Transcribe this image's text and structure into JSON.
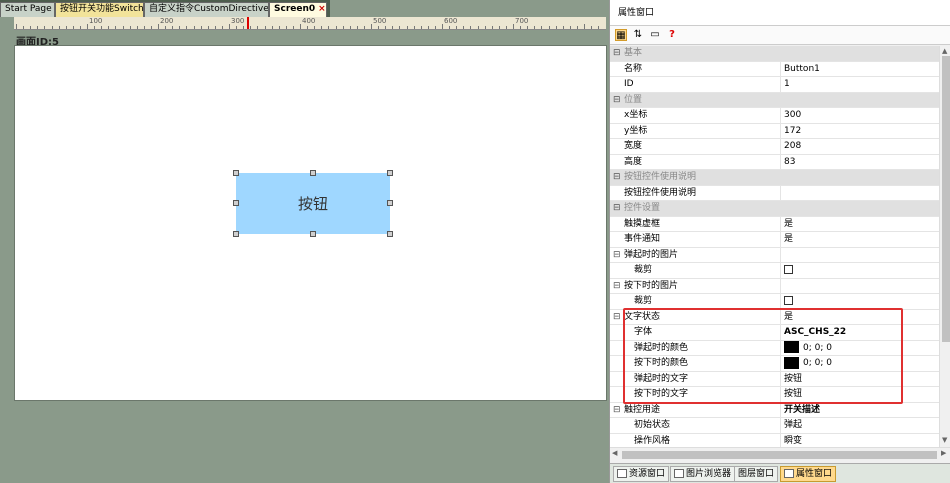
{
  "tabs": [
    {
      "label": "Start Page"
    },
    {
      "label": "按钮开关功能Switch"
    },
    {
      "label": "自定义指令CustomDirectives"
    },
    {
      "label": "Screen0",
      "close": "×"
    }
  ],
  "ruler": {
    "labels": [
      "100",
      "200",
      "300",
      "400",
      "500",
      "600",
      "700"
    ]
  },
  "screen_label": "画面ID:5",
  "canvas_button": {
    "label": "按钮"
  },
  "props": {
    "title": "属性窗口",
    "toolbar_icons": [
      "categorized-icon",
      "sort-alpha-icon",
      "property-pages-icon",
      "help-icon"
    ],
    "help_glyph": "?",
    "rows": [
      {
        "type": "cat",
        "name": "基本"
      },
      {
        "type": "prop",
        "name": "名称",
        "value": "Button1"
      },
      {
        "type": "prop",
        "name": "ID",
        "value": "1"
      },
      {
        "type": "cat",
        "name": "位置"
      },
      {
        "type": "prop",
        "name": "x坐标",
        "value": "300"
      },
      {
        "type": "prop",
        "name": "y坐标",
        "value": "172"
      },
      {
        "type": "prop",
        "name": "宽度",
        "value": "208"
      },
      {
        "type": "prop",
        "name": "高度",
        "value": "83"
      },
      {
        "type": "cat",
        "name": "按钮控件使用说明"
      },
      {
        "type": "prop",
        "name": "按钮控件使用说明",
        "value": ""
      },
      {
        "type": "cat",
        "name": "控件设置"
      },
      {
        "type": "prop",
        "name": "触摸虚框",
        "value": "是"
      },
      {
        "type": "prop",
        "name": "事件通知",
        "value": "是"
      },
      {
        "type": "group",
        "name": "弹起时的图片",
        "value": ""
      },
      {
        "type": "sub",
        "name": "裁剪",
        "value": "",
        "checkbox": true
      },
      {
        "type": "group",
        "name": "按下时的图片",
        "value": ""
      },
      {
        "type": "sub",
        "name": "裁剪",
        "value": "",
        "checkbox": true
      },
      {
        "type": "group",
        "name": "文字状态",
        "value": "是"
      },
      {
        "type": "sub",
        "name": "字体",
        "value": "ASC_CHS_22",
        "bold": true
      },
      {
        "type": "sub",
        "name": "弹起时的颜色",
        "value": "0; 0; 0",
        "swatch": "#000000"
      },
      {
        "type": "sub",
        "name": "按下时的颜色",
        "value": "0; 0; 0",
        "swatch": "#000000"
      },
      {
        "type": "sub",
        "name": "弹起时的文字",
        "value": "按钮"
      },
      {
        "type": "sub",
        "name": "按下时的文字",
        "value": "按钮"
      },
      {
        "type": "group",
        "name": "触控用途",
        "value": "开关描述",
        "bold": true
      },
      {
        "type": "sub",
        "name": "初始状态",
        "value": "弹起"
      },
      {
        "type": "sub",
        "name": "操作风格",
        "value": "瞬变"
      }
    ]
  },
  "bottom_tabs": [
    {
      "label": "资源窗口"
    },
    {
      "label": "图片浏览器"
    },
    {
      "label": "图层窗口"
    },
    {
      "label": "属性窗口"
    }
  ],
  "colors": {
    "accent_highlight": "#e03030",
    "button_fill": "#9fd7ff",
    "canvas_bg": "#ffffff",
    "workspace_bg": "#8a9a8a"
  }
}
